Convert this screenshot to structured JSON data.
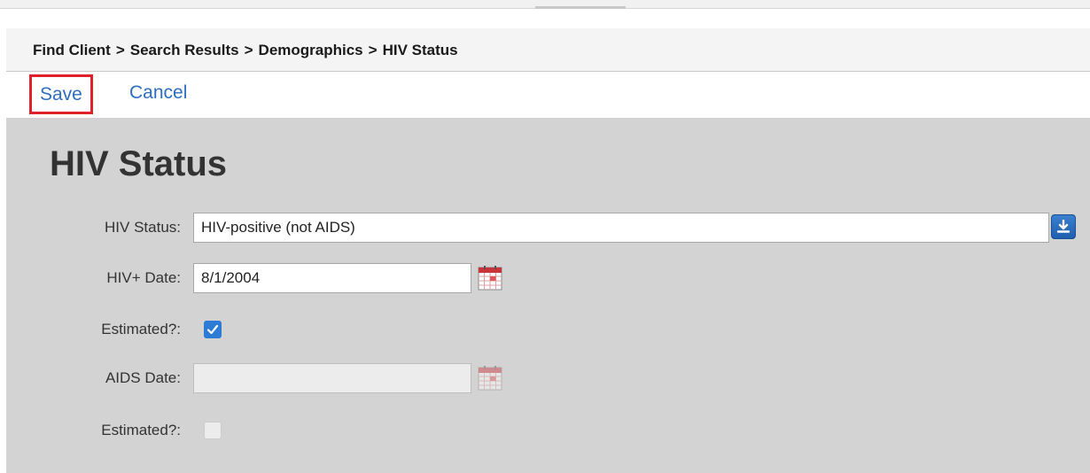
{
  "breadcrumb": {
    "items": [
      "Find Client",
      "Search Results",
      "Demographics",
      "HIV Status"
    ],
    "separator": ">"
  },
  "actions": {
    "save_label": "Save",
    "cancel_label": "Cancel"
  },
  "page": {
    "title": "HIV Status"
  },
  "form": {
    "hiv_status": {
      "label": "HIV Status:",
      "value": "HIV-positive (not AIDS)"
    },
    "hiv_date": {
      "label": "HIV+ Date:",
      "value": "8/1/2004"
    },
    "hiv_estimated": {
      "label": "Estimated?:",
      "checked": true
    },
    "aids_date": {
      "label": "AIDS Date:",
      "value": "",
      "disabled": true
    },
    "aids_estimated": {
      "label": "Estimated?:",
      "checked": false,
      "disabled": true
    }
  },
  "colors": {
    "link": "#2d6ebf",
    "highlight_border": "#e0202b",
    "checkbox_checked": "#2e7bd6",
    "panel_background": "#d3d3d3"
  },
  "icons": {
    "dropdown": "download-arrow-icon",
    "calendar": "calendar-icon",
    "checkmark": "checkmark-icon"
  }
}
